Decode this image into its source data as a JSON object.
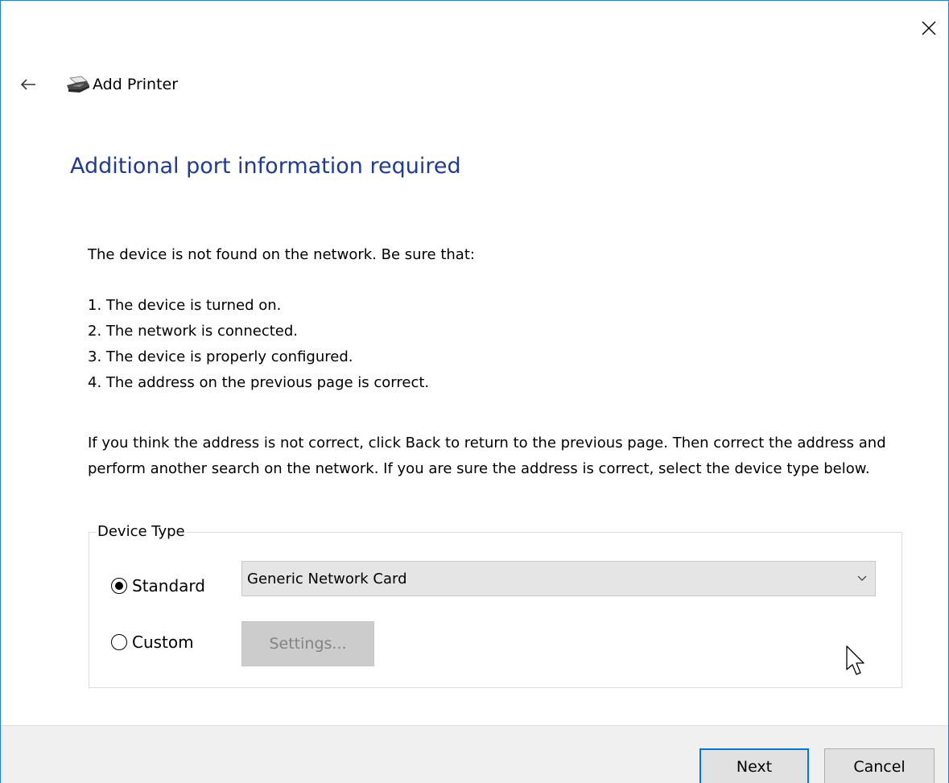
{
  "window": {
    "title": "Add Printer",
    "close_icon": "close-icon",
    "back_icon": "back-arrow-icon",
    "app_icon": "printer-icon"
  },
  "page": {
    "heading": "Additional port information required",
    "intro": "The device is not found on the network.  Be sure that:",
    "steps": [
      "1.  The device is turned on.",
      "2.  The network is connected.",
      "3.  The device is properly configured.",
      "4.  The address on the previous page is correct."
    ],
    "advice": "If you think the address is not correct, click Back to return to the previous page.  Then correct the address and perform another search on the network.  If you are sure the address is correct, select the device type below."
  },
  "device_type": {
    "legend": "Device Type",
    "standard": {
      "label": "Standard",
      "checked": true,
      "selected_value": "Generic Network Card"
    },
    "custom": {
      "label": "Custom",
      "checked": false,
      "settings_label": "Settings...",
      "settings_enabled": false
    }
  },
  "footer": {
    "next_label": "Next",
    "cancel_label": "Cancel"
  },
  "colors": {
    "heading": "#1e3a9a",
    "focus_border": "#0078d7",
    "window_border": "#2b7cd3"
  }
}
